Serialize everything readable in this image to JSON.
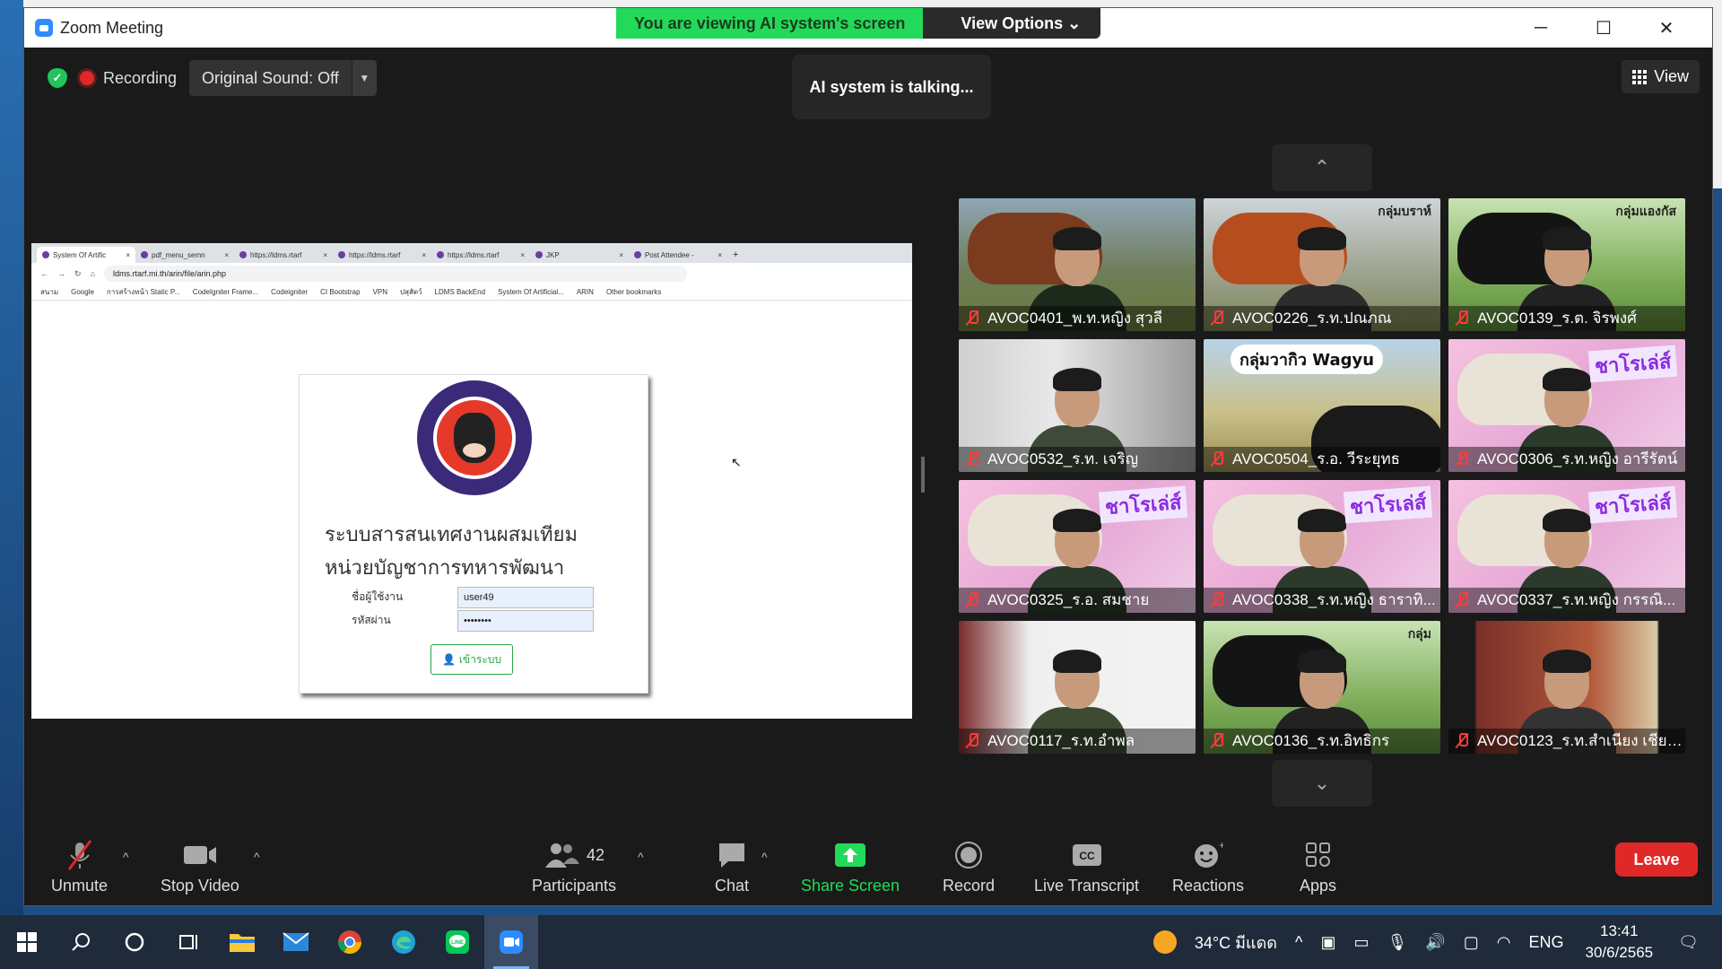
{
  "window": {
    "title": "Zoom Meeting"
  },
  "banner": {
    "viewing": "You are viewing AI system's screen",
    "view_options": "View Options ⌄"
  },
  "top": {
    "recording": "Recording",
    "original_sound": "Original Sound: Off",
    "talking": "AI system is talking...",
    "view": "View"
  },
  "shared_screen": {
    "tabs": [
      {
        "label": "System Of Artific",
        "active": true
      },
      {
        "label": "pdf_menu_semn"
      },
      {
        "label": "https://ldms.rtarf"
      },
      {
        "label": "https://ldms.rtarf"
      },
      {
        "label": "https://ldms.rtarf"
      },
      {
        "label": "JKP"
      },
      {
        "label": "Post Attendee -"
      }
    ],
    "url": "ldms.rtarf.mi.th/arin/file/arin.php",
    "bookmarks": [
      "สนาม",
      "Google",
      "การสร้างหน้า Static P...",
      "CodeIgniter Frame...",
      "Codeigniter",
      "CI Bootstrap",
      "VPN",
      "ปสุสัตว์",
      "LDMS BackEnd",
      "System Of Artificial...",
      "ARIN",
      "Other bookmarks"
    ],
    "login": {
      "title_line1": "ระบบสารสนเทศงานผสมเทียม",
      "title_line2": "หน่วยบัญชาการทหารพัฒนา",
      "username_label": "ชื่อผู้ใช้งาน",
      "password_label": "รหัสผ่าน",
      "username_value": "user49",
      "password_value": "••••••••",
      "submit_label": "เข้าระบบ"
    }
  },
  "participants": [
    {
      "name": "AVOC0401_พ.ท.หญิง สุวลี",
      "scene": "cow-brown",
      "sign": ""
    },
    {
      "name": "AVOC0226_ร.ท.ปณภณ",
      "scene": "cow-red",
      "sign": "กลุ่มบราห์"
    },
    {
      "name": "AVOC0139_ร.ต. จิรพงศ์",
      "scene": "cow-black",
      "sign": "กลุ่มแองกัส"
    },
    {
      "name": "AVOC0532_ร.ท. เจริญ",
      "scene": "room",
      "sign": ""
    },
    {
      "name": "AVOC0504_ร.อ. วีระยุทธ",
      "scene": "wagyu",
      "sign": "กลุ่มวากิว Wagyu"
    },
    {
      "name": "AVOC0306_ร.ท.หญิง อารีรัตน์",
      "scene": "charolais",
      "sign": "ชาโรเล่ส์"
    },
    {
      "name": "AVOC0325_ร.อ. สมชาย",
      "scene": "charolais",
      "sign": "ชาโรเล่ส์"
    },
    {
      "name": "AVOC0338_ร.ท.หญิง ธาราทิ...",
      "scene": "charolais",
      "sign": "ชาโรเล่ส์"
    },
    {
      "name": "AVOC0337_ร.ท.หญิง กรรณิ...",
      "scene": "charolais",
      "sign": "ชาโรเล่ส์"
    },
    {
      "name": "AVOC0117_ร.ท.อำพล",
      "scene": "office",
      "sign": ""
    },
    {
      "name": "AVOC0136_ร.ท.อิทธิกร",
      "scene": "cow-black",
      "sign": "กลุ่ม"
    },
    {
      "name": "AVOC0123_ร.ท.สำเนียง เชียง...",
      "scene": "house",
      "sign": ""
    }
  ],
  "bottombar": {
    "unmute": "Unmute",
    "stop_video": "Stop Video",
    "participants": "Participants",
    "participant_count": "42",
    "chat": "Chat",
    "share_screen": "Share Screen",
    "record": "Record",
    "live_transcript": "Live Transcript",
    "reactions": "Reactions",
    "apps": "Apps",
    "leave": "Leave"
  },
  "taskbar": {
    "weather": "34°C มีแดด",
    "lang": "ENG",
    "time": "13:41",
    "date": "30/6/2565"
  },
  "colors": {
    "share_green": "#23d959",
    "leave_red": "#e02828",
    "zoom_blue": "#2d8cff"
  }
}
